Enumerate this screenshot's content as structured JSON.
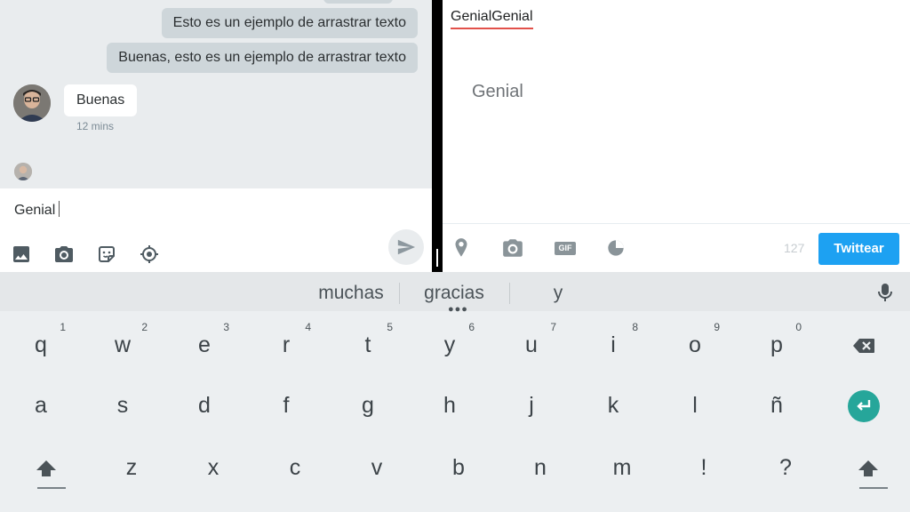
{
  "chat": {
    "messages_out": [
      "Esto es un ejemplo de arrastrar texto",
      "Buenas, esto es un ejemplo de arrastrar texto"
    ],
    "message_in": {
      "text": "Buenas",
      "time": "12 mins"
    },
    "composer": {
      "value": "Genial",
      "tools": [
        "image-icon",
        "camera-icon",
        "sticker-icon",
        "location-target-icon"
      ],
      "send_icon": "send-icon"
    }
  },
  "tweet": {
    "typed_text": "GenialGenial",
    "drag_text": "Genial",
    "char_count": "127",
    "button_label": "Twittear",
    "tools": [
      "location-pin-icon",
      "camera-icon",
      "gif-icon",
      "poll-icon"
    ],
    "gif_label": "GIF"
  },
  "keyboard": {
    "suggestions": [
      "muchas",
      "gracias",
      "y"
    ],
    "row1": [
      {
        "key": "q",
        "hint": "1"
      },
      {
        "key": "w",
        "hint": "2"
      },
      {
        "key": "e",
        "hint": "3"
      },
      {
        "key": "r",
        "hint": "4"
      },
      {
        "key": "t",
        "hint": "5"
      },
      {
        "key": "y",
        "hint": "6"
      },
      {
        "key": "u",
        "hint": "7"
      },
      {
        "key": "i",
        "hint": "8"
      },
      {
        "key": "o",
        "hint": "9"
      },
      {
        "key": "p",
        "hint": "0"
      }
    ],
    "row2": [
      "a",
      "s",
      "d",
      "f",
      "g",
      "h",
      "j",
      "k",
      "l",
      "ñ"
    ],
    "row3": [
      "z",
      "x",
      "c",
      "v",
      "b",
      "n",
      "m",
      "!",
      "?"
    ],
    "special_keys": [
      "backspace-icon",
      "enter-icon",
      "shift-icon",
      "mic-icon"
    ]
  },
  "colors": {
    "tweet_button": "#1da1f2",
    "enter_key": "#26a69a",
    "spell_underline": "#e2514a"
  }
}
